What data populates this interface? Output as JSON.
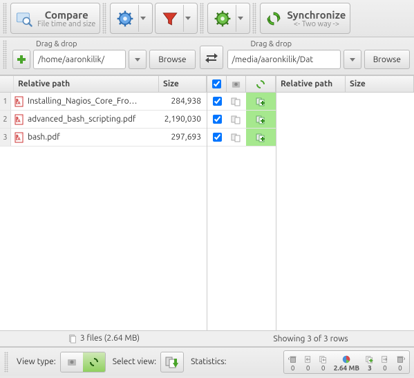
{
  "toolbar": {
    "compare": {
      "title": "Compare",
      "subtitle": "File time and size"
    },
    "sync": {
      "title": "Synchronize",
      "subtitle": "<- Two way ->"
    }
  },
  "paths": {
    "left": {
      "drag_label": "Drag & drop",
      "path": "/home/aaronkilik/",
      "browse": "Browse"
    },
    "right": {
      "drag_label": "Drag & drop",
      "path": "/media/aaronkilik/Dat",
      "browse": "Browse"
    }
  },
  "headers": {
    "relpath": "Relative path",
    "size": "Size"
  },
  "left_files": [
    {
      "name": "Installing_Nagios_Core_Fro…",
      "size": "284,938"
    },
    {
      "name": "advanced_bash_scripting.pdf",
      "size": "2,190,030"
    },
    {
      "name": "bash.pdf",
      "size": "297,693"
    }
  ],
  "left_count_label": "3 files  (2.64 MB)",
  "showing_label": "Showing 3 of 3 rows",
  "bottombar": {
    "view_type": "View type:",
    "select_view": "Select view:",
    "statistics": "Statistics:"
  },
  "stats": {
    "del_left": "0",
    "upd_left": "0",
    "copy_left": "0",
    "total_size": "2.64 MB",
    "copy_right": "3",
    "upd_right": "0",
    "del_right": "0"
  }
}
